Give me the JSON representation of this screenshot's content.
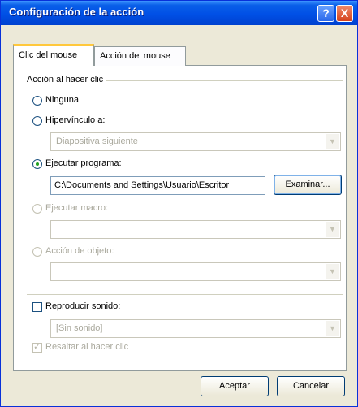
{
  "window": {
    "title": "Configuración de la acción",
    "help_glyph": "?",
    "close_glyph": "X"
  },
  "tabs": [
    {
      "label": "Clic del mouse",
      "active": true
    },
    {
      "label": "Acción del mouse",
      "active": false
    }
  ],
  "group": {
    "label": "Acción al hacer clic"
  },
  "options": {
    "ninguna": {
      "label": "Ninguna",
      "selected": false,
      "enabled": true
    },
    "hipervinculo": {
      "label": "Hipervínculo a:",
      "selected": false,
      "enabled": true,
      "combo_value": "Diapositiva siguiente"
    },
    "ejecutar_programa": {
      "label": "Ejecutar programa:",
      "selected": true,
      "enabled": true,
      "path": "C:\\Documents and Settings\\Usuario\\Escritor",
      "browse_label": "Examinar..."
    },
    "ejecutar_macro": {
      "label": "Ejecutar macro:",
      "selected": false,
      "enabled": false,
      "combo_value": ""
    },
    "accion_objeto": {
      "label": "Acción de objeto:",
      "selected": false,
      "enabled": false,
      "combo_value": ""
    }
  },
  "sound": {
    "label": "Reproducir sonido:",
    "checked": false,
    "combo_value": "[Sin sonido]"
  },
  "highlight": {
    "label": "Resaltar al hacer clic",
    "checked": true,
    "enabled": false
  },
  "footer": {
    "ok_label": "Aceptar",
    "cancel_label": "Cancelar"
  },
  "colors": {
    "title_bar": "#0050e6",
    "dialog_bg": "#ece9d8",
    "selected_radio": "#21a121"
  }
}
